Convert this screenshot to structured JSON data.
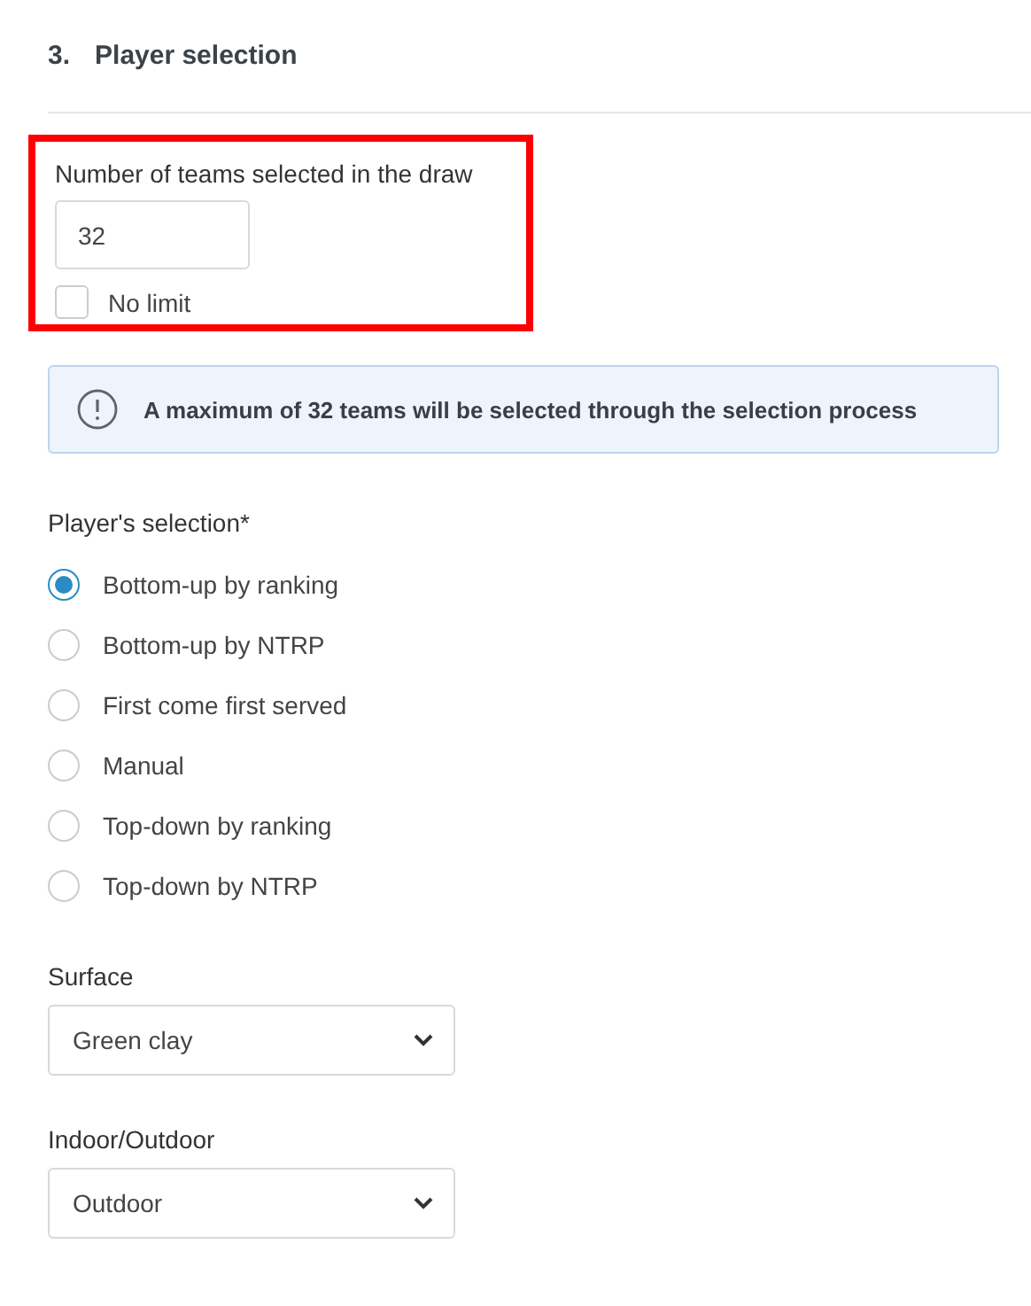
{
  "section": {
    "number": "3.",
    "title": "Player selection"
  },
  "teams_field": {
    "label": "Number of teams selected in the draw",
    "value": "32",
    "highlighted": true,
    "no_limit": {
      "label": "No limit",
      "checked": false
    }
  },
  "info": {
    "text": "A maximum of 32 teams will be selected through the selection process"
  },
  "players_selection": {
    "label": "Player's selection*",
    "options": [
      {
        "label": "Bottom-up by ranking",
        "selected": true
      },
      {
        "label": "Bottom-up by NTRP",
        "selected": false
      },
      {
        "label": "First come first served",
        "selected": false
      },
      {
        "label": "Manual",
        "selected": false
      },
      {
        "label": "Top-down by ranking",
        "selected": false
      },
      {
        "label": "Top-down by NTRP",
        "selected": false
      }
    ]
  },
  "selects": [
    {
      "label": "Surface",
      "value": "Green clay"
    },
    {
      "label": "Indoor/Outdoor",
      "value": "Outdoor"
    }
  ]
}
